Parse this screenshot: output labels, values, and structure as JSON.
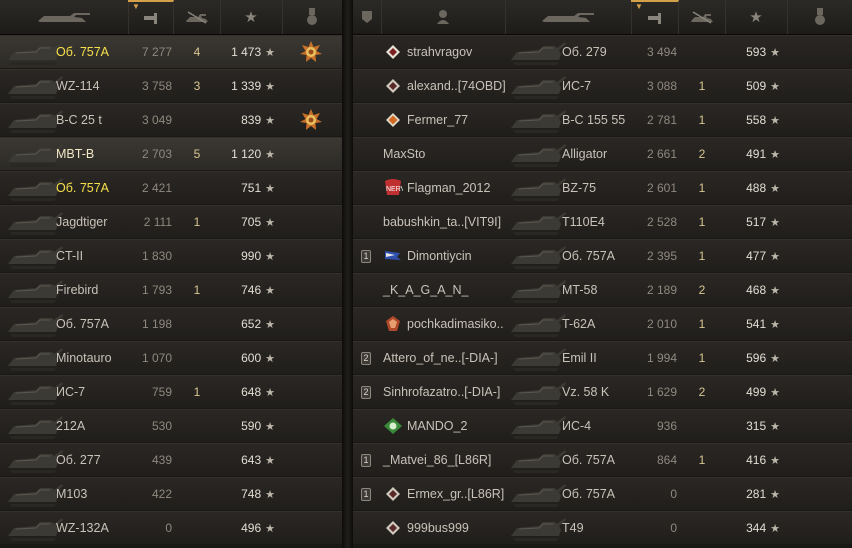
{
  "left_team": [
    {
      "tank": "Об. 757А",
      "damage": "7 277",
      "kills": "4",
      "xp": "1 473",
      "medal": true,
      "style": "me",
      "highlight": true
    },
    {
      "tank": "WZ-114",
      "damage": "3 758",
      "kills": "3",
      "xp": "1 339",
      "medal": false,
      "style": "",
      "highlight": false
    },
    {
      "tank": "B-C 25 t",
      "damage": "3 049",
      "kills": "",
      "xp": "839",
      "medal": true,
      "style": "",
      "highlight": false
    },
    {
      "tank": "MBT-B",
      "damage": "2 703",
      "kills": "5",
      "xp": "1 120",
      "medal": false,
      "style": "",
      "highlight": true
    },
    {
      "tank": "Об. 757А",
      "damage": "2 421",
      "kills": "",
      "xp": "751",
      "medal": false,
      "style": "me",
      "highlight": false
    },
    {
      "tank": "Jagdtiger",
      "damage": "2 111",
      "kills": "1",
      "xp": "705",
      "medal": false,
      "style": "",
      "highlight": false
    },
    {
      "tank": "CT-II",
      "damage": "1 830",
      "kills": "",
      "xp": "990",
      "medal": false,
      "style": "",
      "highlight": false
    },
    {
      "tank": "Firebird",
      "damage": "1 793",
      "kills": "1",
      "xp": "746",
      "medal": false,
      "style": "",
      "highlight": false
    },
    {
      "tank": "Об. 757А",
      "damage": "1 198",
      "kills": "",
      "xp": "652",
      "medal": false,
      "style": "",
      "highlight": false
    },
    {
      "tank": "Minotauro",
      "damage": "1 070",
      "kills": "",
      "xp": "600",
      "medal": false,
      "style": "",
      "highlight": false
    },
    {
      "tank": "ИС-7",
      "damage": "759",
      "kills": "1",
      "xp": "648",
      "medal": false,
      "style": "",
      "highlight": false
    },
    {
      "tank": "212A",
      "damage": "530",
      "kills": "",
      "xp": "590",
      "medal": false,
      "style": "",
      "highlight": false
    },
    {
      "tank": "Об. 277",
      "damage": "439",
      "kills": "",
      "xp": "643",
      "medal": false,
      "style": "",
      "highlight": false
    },
    {
      "tank": "M103",
      "damage": "422",
      "kills": "",
      "xp": "748",
      "medal": false,
      "style": "",
      "highlight": false
    },
    {
      "tank": "WZ-132A",
      "damage": "0",
      "kills": "",
      "xp": "496",
      "medal": false,
      "style": "",
      "highlight": false
    }
  ],
  "right_team": [
    {
      "player": "strahvragov",
      "rank": "",
      "clan_icon": "chevron-badge-icon",
      "tank": "Об. 279",
      "damage": "3 494",
      "kills": "",
      "xp": "593"
    },
    {
      "player": "alexand..[74OBD]",
      "rank": "",
      "clan_icon": "diamond-badge-icon",
      "tank": "ИС-7",
      "damage": "3 088",
      "kills": "1",
      "xp": "509"
    },
    {
      "player": "Fermer_77",
      "rank": "",
      "clan_icon": "orange-diamond-icon",
      "tank": "B-C 155 55",
      "damage": "2 781",
      "kills": "1",
      "xp": "558"
    },
    {
      "player": "MaxSto",
      "rank": "",
      "clan_icon": "",
      "tank": "Alligator",
      "damage": "2 661",
      "kills": "2",
      "xp": "491"
    },
    {
      "player": "Flagman_2012",
      "rank": "",
      "clan_icon": "nerv-logo-icon",
      "tank": "BZ-75",
      "damage": "2 601",
      "kills": "1",
      "xp": "488"
    },
    {
      "player": "babushkin_ta..[VIT9I]",
      "rank": "",
      "clan_icon": "",
      "tank": "T110E4",
      "damage": "2 528",
      "kills": "1",
      "xp": "517"
    },
    {
      "player": "Dimontiycin",
      "rank": "1",
      "clan_icon": "flag-icon",
      "tank": "Об. 757А",
      "damage": "2 395",
      "kills": "1",
      "xp": "477"
    },
    {
      "player": "_K_A_G_A_N_",
      "rank": "",
      "clan_icon": "",
      "tank": "MT-58",
      "damage": "2 189",
      "kills": "2",
      "xp": "468"
    },
    {
      "player": "pochkadimasiko..",
      "rank": "",
      "clan_icon": "gem-icon",
      "tank": "T-62A",
      "damage": "2 010",
      "kills": "1",
      "xp": "541"
    },
    {
      "player": "Attero_of_ne..[-DIA-]",
      "rank": "2",
      "clan_icon": "",
      "tank": "Emil II",
      "damage": "1 994",
      "kills": "1",
      "xp": "596"
    },
    {
      "player": "Sinhrofazatro..[-DIA-]",
      "rank": "2",
      "clan_icon": "",
      "tank": "Vz. 58 K",
      "damage": "1 629",
      "kills": "2",
      "xp": "499"
    },
    {
      "player": "MANDO_2",
      "rank": "",
      "clan_icon": "green-emblem-icon",
      "tank": "ИС-4",
      "damage": "936",
      "kills": "",
      "xp": "315"
    },
    {
      "player": "_Matvei_86_[L86R]",
      "rank": "1",
      "clan_icon": "",
      "tank": "Об. 757А",
      "damage": "864",
      "kills": "1",
      "xp": "416"
    },
    {
      "player": "Ermex_gr..[L86R]",
      "rank": "1",
      "clan_icon": "diamond-badge-icon",
      "tank": "Об. 757А",
      "damage": "0",
      "kills": "",
      "xp": "281"
    },
    {
      "player": "999bus999",
      "rank": "",
      "clan_icon": "diamond-badge-icon",
      "tank": "T49",
      "damage": "0",
      "kills": "",
      "xp": "344"
    }
  ],
  "star_glyph": "★",
  "colors": {
    "me": "#f6e04a",
    "accent": "#d4a04a",
    "panel": "#1a1815"
  }
}
